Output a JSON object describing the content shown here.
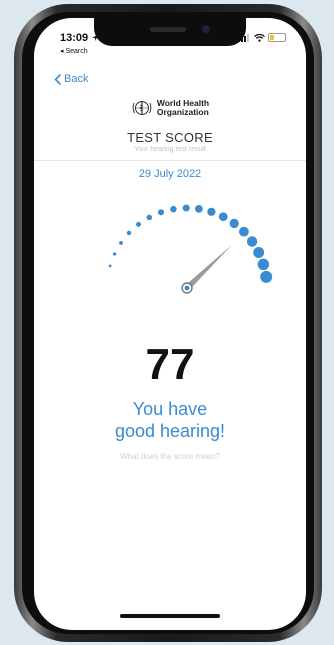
{
  "status_bar": {
    "time": "13:09",
    "back_app_label": "◂ Search"
  },
  "nav": {
    "back_label": "Back"
  },
  "organization": {
    "line1": "World Health",
    "line2": "Organization"
  },
  "header": {
    "title": "TEST SCORE",
    "subtitle": "Your hearing test result"
  },
  "result": {
    "date": "29 July 2022",
    "score": "77",
    "score_value": 77,
    "score_max": 100,
    "verdict_line1": "You have",
    "verdict_line2": "good hearing!",
    "help_link": "What does the score mean?"
  },
  "colors": {
    "accent": "#3b8bd0",
    "gauge_dot": "#3b8bd0",
    "battery": "#f3c417",
    "needle": "#9a9a9a"
  },
  "status_bar_levels": {
    "signal_bars_filled": 3,
    "battery_fraction": 0.25
  }
}
